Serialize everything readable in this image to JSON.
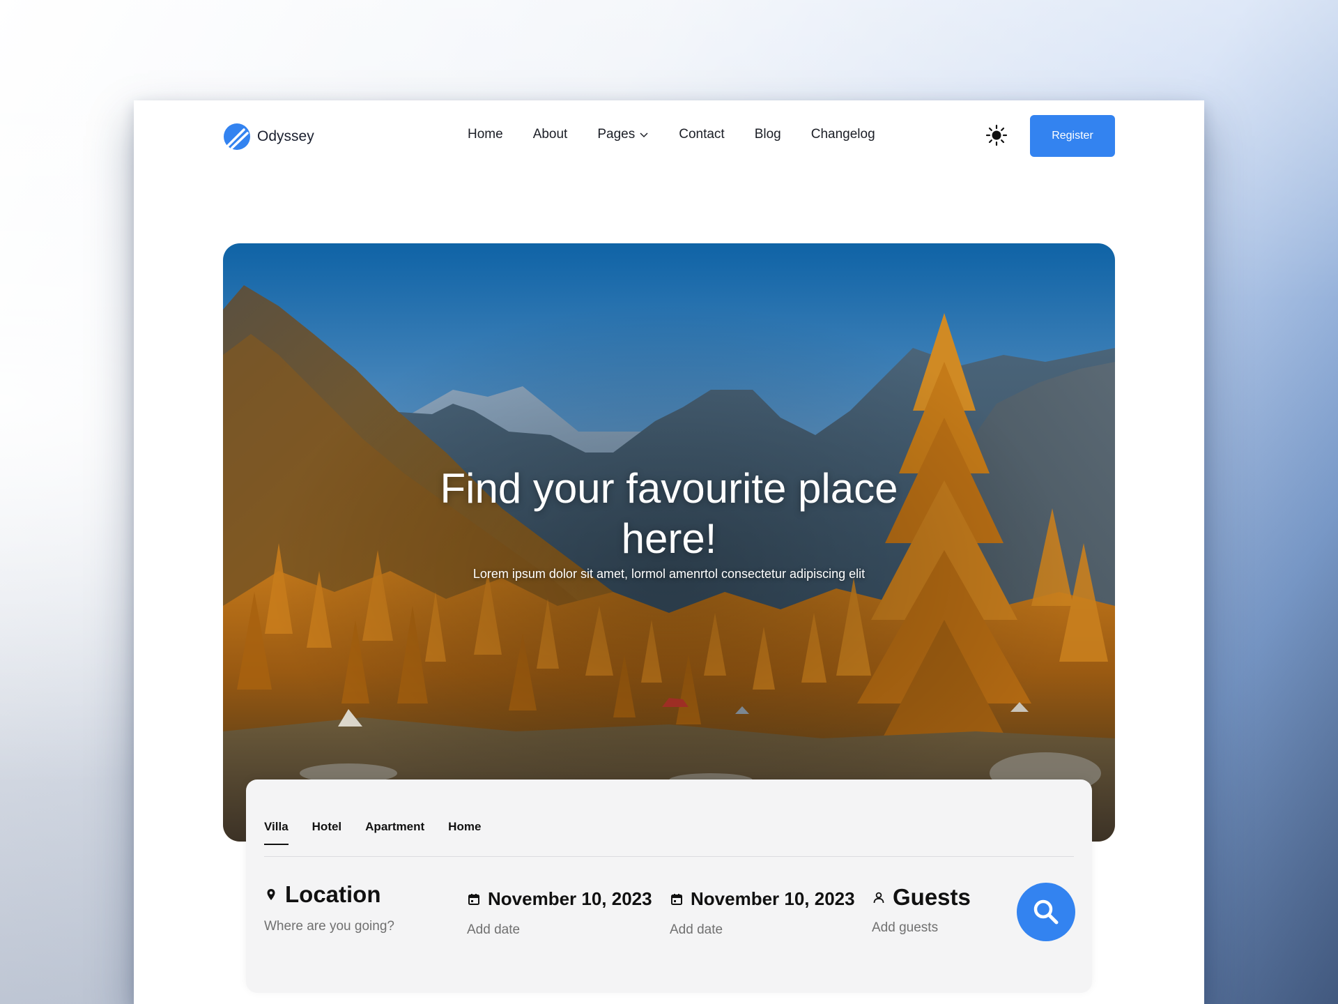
{
  "brand": {
    "name": "Odyssey",
    "accent": "#3383f0"
  },
  "nav": {
    "items": [
      {
        "label": "Home"
      },
      {
        "label": "About"
      },
      {
        "label": "Pages",
        "has_dropdown": true
      },
      {
        "label": "Contact"
      },
      {
        "label": "Blog"
      },
      {
        "label": "Changelog"
      }
    ],
    "theme_icon": "sun-icon",
    "register_label": "Register"
  },
  "hero": {
    "title": "Find your favourite place here!",
    "subtitle": "Lorem ipsum dolor sit amet, lormol amenrtol consectetur adipiscing elit"
  },
  "search": {
    "tabs": [
      {
        "label": "Villa",
        "active": true
      },
      {
        "label": "Hotel"
      },
      {
        "label": "Apartment"
      },
      {
        "label": "Home"
      }
    ],
    "location": {
      "label": "Location",
      "placeholder": "Where are you going?",
      "icon": "map-pin-icon"
    },
    "checkin": {
      "label": "November 10, 2023",
      "placeholder": "Add date",
      "icon": "calendar-icon"
    },
    "checkout": {
      "label": "November 10, 2023",
      "placeholder": "Add date",
      "icon": "calendar-icon"
    },
    "guests": {
      "label": "Guests",
      "placeholder": "Add guests",
      "icon": "user-icon"
    },
    "button_icon": "search-icon"
  }
}
